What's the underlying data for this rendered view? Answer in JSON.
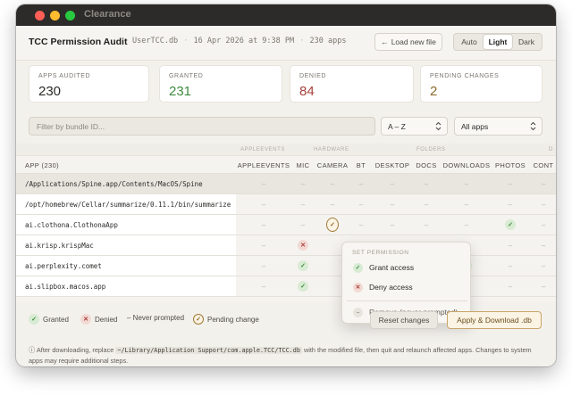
{
  "window": {
    "title": "Clearance"
  },
  "header": {
    "app_title": "TCC Permission Audit",
    "file": "UserTCC.db",
    "date": "16 Apr 2026 at 9:38 PM",
    "apps_count": "230 apps",
    "load_button": "Load new file",
    "theme_options": [
      "Auto",
      "Light",
      "Dark"
    ],
    "theme_selected": "Light"
  },
  "stats": [
    {
      "label": "APPS AUDITED",
      "value": "230",
      "tone": "neutral"
    },
    {
      "label": "GRANTED",
      "value": "231",
      "tone": "green"
    },
    {
      "label": "DENIED",
      "value": "84",
      "tone": "red"
    },
    {
      "label": "PENDING CHANGES",
      "value": "2",
      "tone": "amber"
    }
  ],
  "filter": {
    "placeholder": "Filter by bundle ID...",
    "value": ""
  },
  "sort_select": {
    "value": "A – Z"
  },
  "scope_select": {
    "value": "All apps"
  },
  "table": {
    "groups": [
      "APPLEEVENTS",
      "HARDWARE",
      "FOLDERS",
      "D"
    ],
    "app_column": "APP (230)",
    "columns": [
      "APPLEEVENTS",
      "MIC",
      "CAMERA",
      "BT",
      "DESKTOP",
      "DOCS",
      "DOWNLOADS",
      "PHOTOS",
      "CONT"
    ],
    "rows": [
      {
        "name": "/Applications/Spine.app/Contents/MacOS/Spine",
        "highlighted": true,
        "cells": [
          "none",
          "none",
          "none",
          "none",
          "none",
          "none",
          "none",
          "none",
          "none"
        ]
      },
      {
        "name": "/opt/homebrew/Cellar/summarize/0.11.1/bin/summarize",
        "highlighted": false,
        "cells": [
          "none",
          "none",
          "none",
          "none",
          "none",
          "none",
          "none",
          "none",
          "none"
        ]
      },
      {
        "name": "ai.clothona.ClothonaApp",
        "highlighted": false,
        "cells": [
          "none",
          "none",
          "pending",
          "none",
          "none",
          "none",
          "none",
          "granted",
          "none"
        ]
      },
      {
        "name": "ai.krisp.krispMac",
        "highlighted": false,
        "cells": [
          "none",
          "denied",
          "",
          "",
          "",
          "",
          "",
          "none",
          "none"
        ]
      },
      {
        "name": "ai.perplexity.comet",
        "highlighted": false,
        "cells": [
          "none",
          "granted",
          "",
          "",
          "",
          "",
          "granted",
          "none",
          "none"
        ]
      },
      {
        "name": "ai.slipbox.macos.app",
        "highlighted": false,
        "cells": [
          "none",
          "granted",
          "",
          "",
          "",
          "",
          "",
          "none",
          "none"
        ]
      }
    ],
    "empty_glyph": "–"
  },
  "popover": {
    "title": "SET PERMISSION",
    "grant": "Grant access",
    "deny": "Deny access",
    "remove": "Remove (never prompted)"
  },
  "legend": {
    "granted": "Granted",
    "denied": "Denied",
    "never": "– Never prompted",
    "pending": "Pending change"
  },
  "actions": {
    "reset": "Reset changes",
    "apply": "Apply & Download .db"
  },
  "footnote": {
    "before": "ⓘ After downloading, replace ",
    "path": "~/Library/Application Support/com.apple.TCC/TCC.db",
    "after": " with the modified file, then quit and relaunch affected apps. Changes to system apps may require additional steps."
  },
  "colors": {
    "granted": "#3f8a3f",
    "denied": "#a5403a",
    "pending": "#8c6a2b",
    "titlebar": "#2c2b29"
  },
  "icons": {
    "load": "arrow-left-icon",
    "select": "chevron-updown-icon",
    "granted": "check-icon",
    "denied": "x-icon",
    "remove": "minus-icon"
  }
}
